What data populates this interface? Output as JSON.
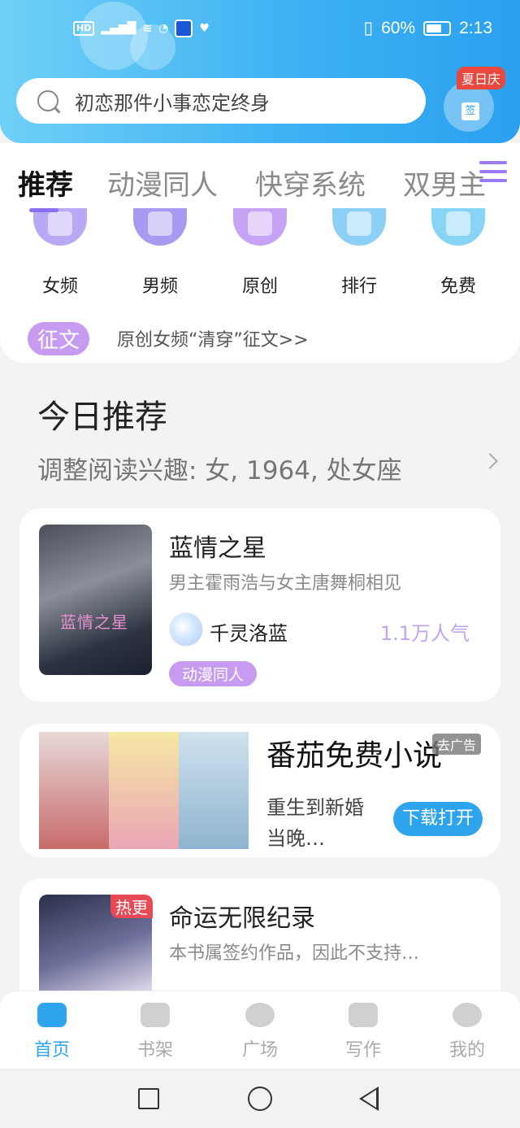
{
  "status_bar": {
    "left_icons": [
      "hd-icon",
      "signal-icon",
      "wifi-icon",
      "app-icon",
      "notification-icon",
      "heart-icon"
    ],
    "hd_label": "HD",
    "battery": "60%",
    "time": "2:13"
  },
  "search": {
    "placeholder": "初恋那件小事恋定终身"
  },
  "signin": {
    "badge": "夏日庆",
    "label": "签"
  },
  "tabs": [
    "推荐",
    "动漫同人",
    "快穿系统",
    "双男主"
  ],
  "categories": [
    {
      "label": "女频",
      "color": "#b9a9f5"
    },
    {
      "label": "男频",
      "color": "#a999f0"
    },
    {
      "label": "原创",
      "color": "#c6a3f4"
    },
    {
      "label": "排行",
      "color": "#8cd0f7"
    },
    {
      "label": "免费",
      "color": "#88d4f6"
    }
  ],
  "contest": {
    "tag": "征文",
    "text": "原创女频“清穿”征文>>"
  },
  "today": {
    "title": "今日推荐",
    "subtitle": "调整阅读兴趣: 女, 1964, 处女座"
  },
  "book1": {
    "cover_text": "蓝情之星",
    "title": "蓝情之星",
    "desc": "男主霍雨浩与女主唐舞桐相见",
    "author": "千灵洛蓝",
    "popularity": "1.1万人气",
    "tag": "动漫同人"
  },
  "ad": {
    "title": "番茄免费小说",
    "close": "去广告",
    "desc": "重生到新婚当晚…",
    "button": "下载打开"
  },
  "book2": {
    "badge": "热更",
    "title": "命运无限纪录",
    "desc": "本书属签约作品，因此不支持…"
  },
  "bottom_nav": [
    {
      "label": "首页",
      "icon": "home-icon",
      "active": true
    },
    {
      "label": "书架",
      "icon": "bookshelf-icon",
      "active": false
    },
    {
      "label": "广场",
      "icon": "planet-icon",
      "active": false
    },
    {
      "label": "写作",
      "icon": "pen-icon",
      "active": false
    },
    {
      "label": "我的",
      "icon": "chat-icon",
      "active": false
    }
  ],
  "colors": {
    "accent": "#2ea4ef",
    "purple": "#c79cf0",
    "hot": "#e84a55"
  }
}
